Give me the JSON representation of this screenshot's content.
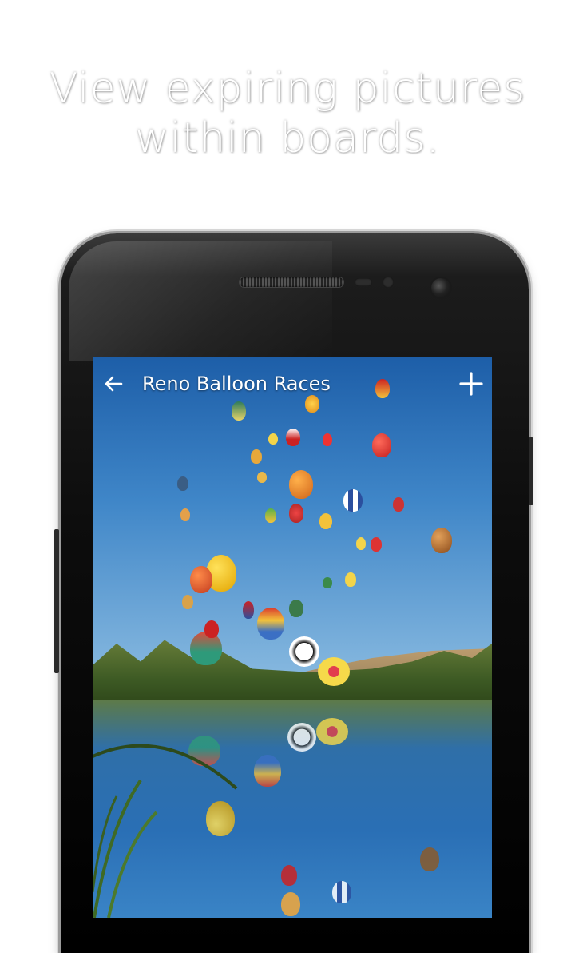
{
  "headline": {
    "line1": "View expiring pictures",
    "line2": "within boards."
  },
  "app_bar": {
    "title": "Reno Balloon Races",
    "back_icon": "arrow-left-icon",
    "add_icon": "plus-icon"
  },
  "colors": {
    "background": "#ffffff",
    "headline_text": "#ffffff",
    "app_bar_text": "#ffffff",
    "sky": "#2f74bf",
    "phone_body": "#0d0d0d"
  },
  "photo": {
    "subject": "balloon-lake-photo"
  }
}
